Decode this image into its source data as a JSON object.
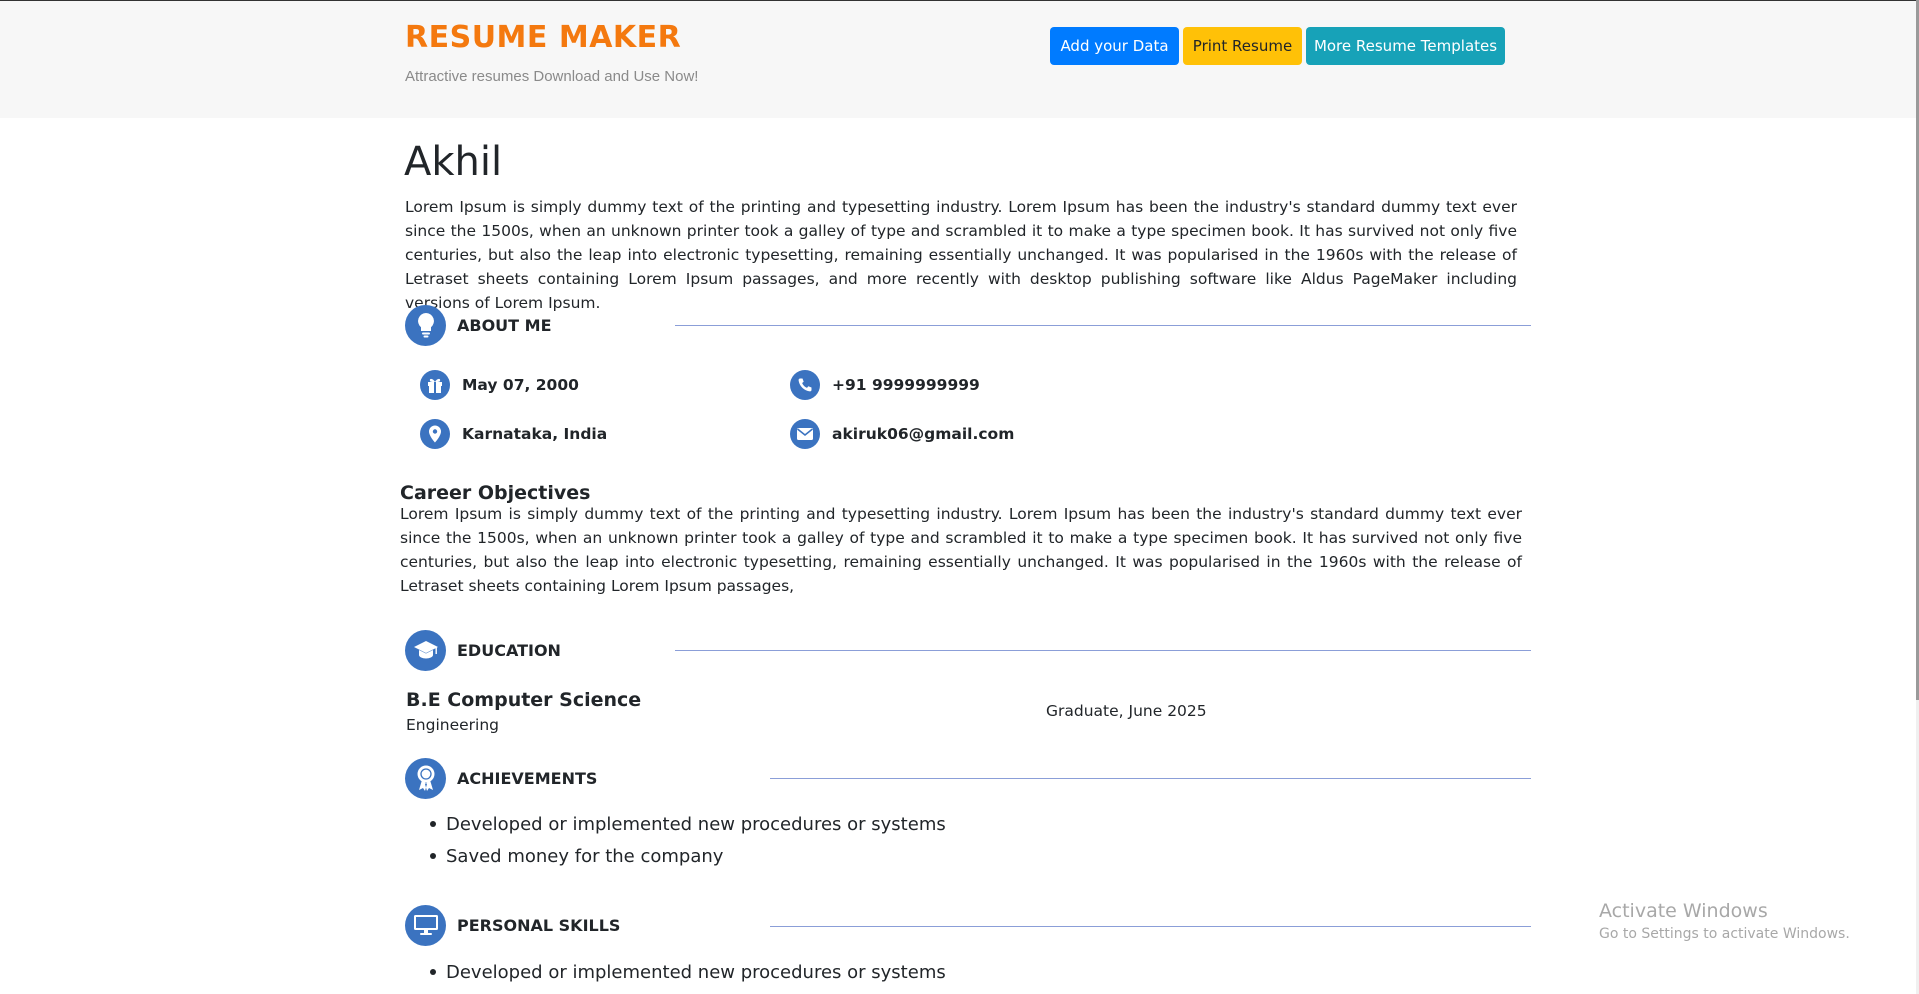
{
  "header": {
    "brand_title": "RESUME MAKER",
    "brand_subtitle": "Attractive resumes Download and Use Now!",
    "buttons": {
      "add_data": "Add your Data",
      "print_resume": "Print Resume",
      "more_templates": "More Resume Templates"
    }
  },
  "resume": {
    "name": "Akhil",
    "intro": "Lorem Ipsum is simply dummy text of the printing and typesetting industry. Lorem Ipsum has been the industry's standard dummy text ever since the 1500s, when an unknown printer took a galley of type and scrambled it to make a type specimen book. It has survived not only five centuries, but also the leap into electronic typesetting, remaining essentially unchanged. It was popularised in the 1960s with the release of Letraset sheets containing Lorem Ipsum passages, and more recently with desktop publishing software like Aldus PageMaker including versions of Lorem Ipsum.",
    "about_me": {
      "title": "ABOUT ME",
      "dob": "May 07, 2000",
      "phone": "+91 9999999999",
      "location": "Karnataka, India",
      "email": "akiruk06@gmail.com"
    },
    "career": {
      "title": "Career Objectives",
      "text": "Lorem Ipsum is simply dummy text of the printing and typesetting industry. Lorem Ipsum has been the industry's standard dummy text ever since the 1500s, when an unknown printer took a galley of type and scrambled it to make a type specimen book. It has survived not only five centuries, but also the leap into electronic typesetting, remaining essentially unchanged. It was popularised in the 1960s with the release of Letraset sheets containing Lorem Ipsum passages,"
    },
    "education": {
      "title": "EDUCATION",
      "degree": "B.E Computer Science",
      "field": "Engineering",
      "graduation": "Graduate, June 2025"
    },
    "achievements": {
      "title": "ACHIEVEMENTS",
      "items": [
        "Developed or implemented new procedures or systems",
        "Saved money for the company"
      ]
    },
    "personal_skills": {
      "title": "PERSONAL SKILLS",
      "items": [
        "Developed or implemented new procedures or systems"
      ]
    }
  },
  "watermark": {
    "title": "Activate Windows",
    "subtitle": "Go to Settings to activate Windows."
  },
  "colors": {
    "brand": "#f4790f",
    "icon_bg": "#3b73c0",
    "primary": "#007bff",
    "warning": "#ffc107",
    "info": "#17a2b8"
  },
  "icons": [
    "lightbulb-icon",
    "gift-icon",
    "phone-icon",
    "location-pin-icon",
    "envelope-icon",
    "graduation-cap-icon",
    "award-icon",
    "monitor-icon"
  ]
}
